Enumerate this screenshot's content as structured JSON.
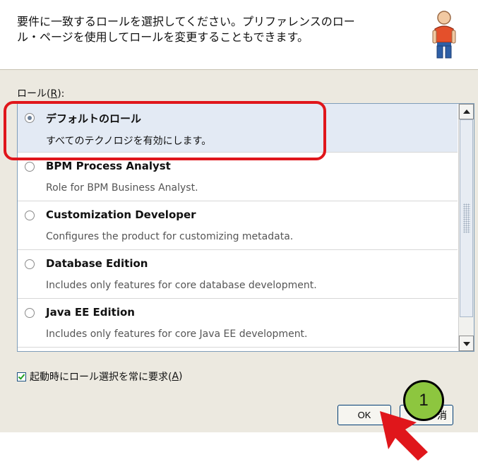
{
  "header": {
    "line1": "要件に一致するロールを選択してください。プリファレンスのロー",
    "line2": "ル・ページを使用してロールを変更することもできます。",
    "icon": "user-icon"
  },
  "roles_label": {
    "text": "ロール(",
    "mnemonic": "R",
    "suffix": "):"
  },
  "roles": [
    {
      "title": "デフォルトのロール",
      "desc": "すべてのテクノロジを有効にします。",
      "selected": true
    },
    {
      "title": "BPM Process Analyst",
      "desc": "Role for BPM Business Analyst.",
      "selected": false
    },
    {
      "title": "Customization Developer",
      "desc": "Configures the product for customizing metadata.",
      "selected": false
    },
    {
      "title": "Database Edition",
      "desc": "Includes only features for core database development.",
      "selected": false
    },
    {
      "title": "Java EE Edition",
      "desc": "Includes only features for core Java EE development.",
      "selected": false
    }
  ],
  "always_prompt": {
    "label": "起動時にロール選択を常に要求(",
    "mnemonic": "A",
    "suffix": ")",
    "checked": true
  },
  "buttons": {
    "ok": "OK",
    "cancel_visible": "消"
  },
  "annotation": {
    "step_number": "1",
    "highlight_color": "#e0161b",
    "badge_color": "#8dc63f",
    "arrow_color": "#e0161b"
  }
}
